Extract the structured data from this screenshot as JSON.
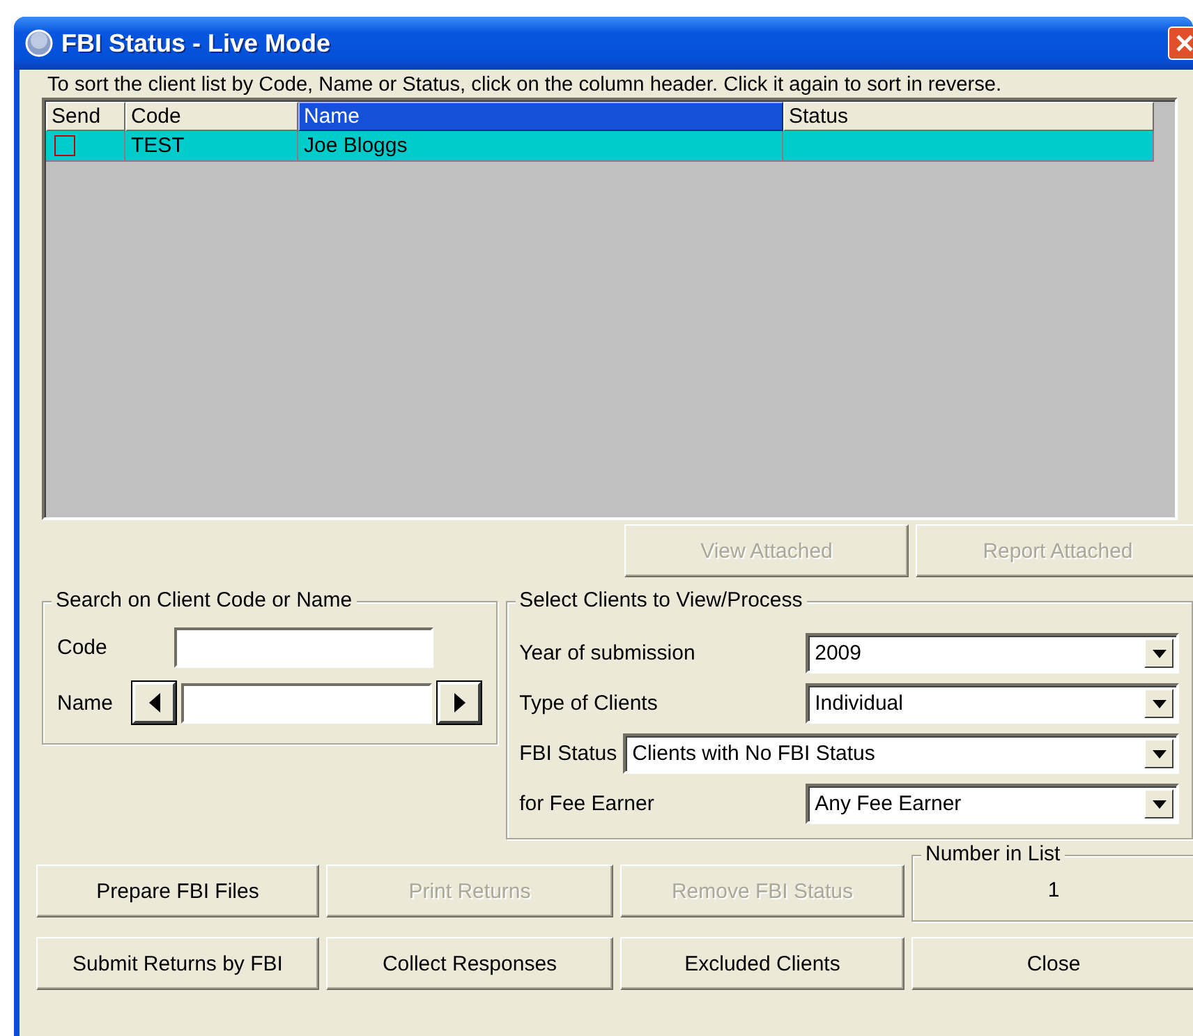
{
  "window": {
    "title": "FBI Status - Live Mode"
  },
  "instructions": "To sort the client list by Code, Name or Status, click on the column header. Click it again to sort in reverse.",
  "table": {
    "columns": [
      {
        "label": "Send",
        "selected": false
      },
      {
        "label": "Code",
        "selected": false
      },
      {
        "label": "Name",
        "selected": true
      },
      {
        "label": "Status",
        "selected": false
      }
    ],
    "rows": [
      {
        "send": false,
        "code": "TEST",
        "name": "Joe Bloggs",
        "selected": true
      }
    ]
  },
  "attached_buttons": [
    {
      "label": "View Attached",
      "disabled": true
    },
    {
      "label": "Report Attached",
      "disabled": true
    }
  ],
  "search_group": {
    "title": "Search on Client Code or Name",
    "code_label": "Code",
    "name_label": "Name"
  },
  "select_group": {
    "title": "Select Clients to View/Process",
    "filters": [
      {
        "kind": "standard",
        "label": "Year of submission",
        "value": "2009"
      },
      {
        "kind": "standard",
        "label": "Type of Clients",
        "value": "Individual"
      },
      {
        "kind": "wide",
        "label": "FBI Status",
        "value": "Clients with No FBI Status"
      },
      {
        "kind": "standard",
        "label": "for Fee Earner",
        "value": "Any Fee Earner"
      }
    ]
  },
  "buttons": [
    {
      "label": "Prepare FBI Files",
      "disabled": false
    },
    {
      "label": "Print Returns",
      "disabled": true
    },
    {
      "label": "Remove FBI Status",
      "disabled": true
    },
    {
      "label": "Submit Returns by FBI",
      "disabled": false
    },
    {
      "label": "Collect Responses",
      "disabled": false
    },
    {
      "label": "Excluded Clients",
      "disabled": false
    },
    {
      "label": "Close",
      "disabled": false
    }
  ],
  "number_in_list": {
    "title": "Number in List",
    "value": "1"
  }
}
